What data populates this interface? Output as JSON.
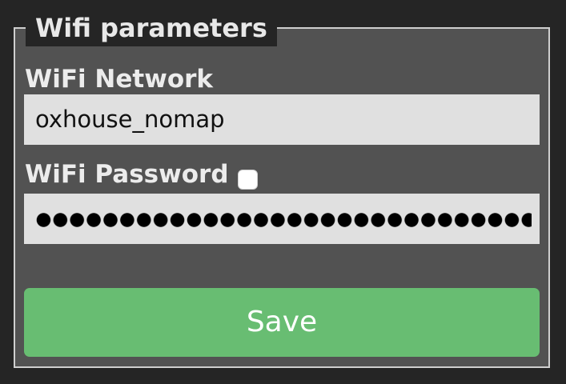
{
  "form": {
    "legend": "Wifi parameters",
    "network": {
      "label": "WiFi Network",
      "value": "oxhouse_nomap"
    },
    "password": {
      "label": "WiFi Password",
      "show_password_checked": false,
      "masked": true
    },
    "save_label": "Save"
  },
  "colors": {
    "page_background": "#252525",
    "panel_background": "#525252",
    "panel_border": "#cfcfcf",
    "label_text": "#ececec",
    "input_background": "#e0e0e0",
    "save_button": "#68bd72",
    "save_text": "#ffffff"
  }
}
